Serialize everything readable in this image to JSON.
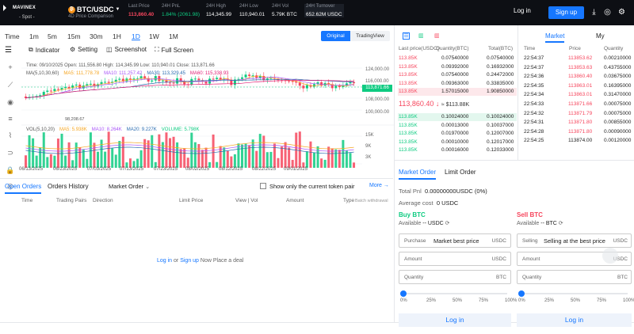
{
  "brand": {
    "name": "MAVINEX",
    "sub": "- Spot -"
  },
  "pair": {
    "name": "BTC/USDC",
    "sub": "4D Price Comparison"
  },
  "stats": [
    {
      "label": "Last Price",
      "value": "113,860.40",
      "color": "#f6465d"
    },
    {
      "label": "24H PnL",
      "value": "1.84% (2061.98)",
      "color": "#0ecb81"
    },
    {
      "label": "24H High",
      "value": "114,345.99",
      "color": "#ffffff"
    },
    {
      "label": "24H Low",
      "value": "110,940.01",
      "color": "#ffffff"
    },
    {
      "label": "24H Vol",
      "value": "5.79K BTC",
      "color": "#ffffff"
    },
    {
      "label": "24H Turnover",
      "value": "652.62M USDC",
      "color": "#ffffff"
    }
  ],
  "header": {
    "login": "Log in",
    "signup": "Sign up"
  },
  "timeframes": [
    "Time",
    "1m",
    "5m",
    "15m",
    "30m",
    "1H",
    "1D",
    "1W",
    "1M"
  ],
  "active_timeframe": "1D",
  "views": {
    "original": "Original",
    "tradingview": "TradingView"
  },
  "toolbar": {
    "indicator": "Indicator",
    "setting": "Setting",
    "screenshot": "Screenshot",
    "fullscreen": "Full Screen"
  },
  "chart_info": {
    "ohlc": "Time: 09/10/2025   Open: 111,556.80   High: 114,345.99   Low: 110,940.01   Close: 113,871.66",
    "ma_title": "MA(5,10,30,60)",
    "ma5": "MA5: 111,778.78",
    "ma10": "MA10: 111,257.42",
    "ma30": "MA30: 113,329.45",
    "ma60": "MA60: 115,338.93",
    "vol_title": "VOL(5,10,20)",
    "vma5": "MA5: 5.938K",
    "vma10": "MA10: 8.264K",
    "vma20": "MA20: 9.227K",
    "volume": "VOLUME: 5.798K",
    "last_label": "113,871.66",
    "low_label": "98,208.67",
    "y_price": [
      "124,000.00",
      "116,000.00",
      "108,000.00",
      "100,000.00"
    ],
    "y_vol": [
      "15K",
      "9K",
      "3K"
    ],
    "x_dates": [
      "06/13/2025",
      "06/23/2025",
      "07/03/2025",
      "07/13/2025",
      "07/23/2025",
      "08/02/2025",
      "08/12/2025",
      "08/22/2025",
      "09/01/2025"
    ]
  },
  "orders": {
    "tabs": [
      "Open Orders",
      "Orders History"
    ],
    "market_order": "Market Order",
    "checkbox": "Show only the current token pair",
    "more": "More",
    "columns": [
      "Time",
      "Trading Pairs",
      "Direction",
      "Limit Price",
      "View | Vol",
      "Amount",
      "Type"
    ],
    "extra_col": "Batch withdrawal",
    "login_prompt_a": "Log in",
    "login_prompt_or": " or ",
    "login_prompt_b": "Sign up",
    "login_prompt_c": " Now Place a deal"
  },
  "orderbook": {
    "headers": [
      "Last price(USDC)",
      "Quantity(BTC)",
      "Total(BTC)"
    ],
    "asks": [
      [
        "113.85K",
        "0.07540000",
        "0.07540000"
      ],
      [
        "113.85K",
        "0.09392000",
        "0.16932000"
      ],
      [
        "113.85K",
        "0.07540000",
        "0.24472000"
      ],
      [
        "113.85K",
        "0.09363000",
        "0.33835000"
      ],
      [
        "113.85K",
        "1.57015000",
        "1.90850000"
      ]
    ],
    "mid_price": "113,860.40",
    "mid_usd": "≈ $113.88K",
    "bids": [
      [
        "113.85K",
        "0.10024000",
        "0.10024000"
      ],
      [
        "113.85K",
        "0.00013000",
        "0.10037000"
      ],
      [
        "113.85K",
        "0.01970000",
        "0.12007000"
      ],
      [
        "113.85K",
        "0.00010000",
        "0.12017000"
      ],
      [
        "113.85K",
        "0.00016000",
        "0.12033000"
      ]
    ]
  },
  "market": {
    "tabs": [
      "Market",
      "My"
    ],
    "headers": [
      "Time",
      "Price",
      "Quantity"
    ],
    "trades": [
      [
        "22:54:37",
        "113853.62",
        "0.00210000",
        "red"
      ],
      [
        "22:54:37",
        "113853.63",
        "0.43755000",
        "red"
      ],
      [
        "22:54:36",
        "113860.40",
        "0.03675000",
        "red"
      ],
      [
        "22:54:35",
        "113863.01",
        "0.16395000",
        "red"
      ],
      [
        "22:54:34",
        "113863.01",
        "0.31470000",
        "red"
      ],
      [
        "22:54:33",
        "113871.66",
        "0.00075000",
        "red"
      ],
      [
        "22:54:32",
        "113871.79",
        "0.00075000",
        "red"
      ],
      [
        "22:54:31",
        "113871.80",
        "0.00855000",
        "red"
      ],
      [
        "22:54:28",
        "113871.80",
        "0.00090000",
        "red"
      ],
      [
        "22:54:25",
        "113874.00",
        "0.00120000",
        "black"
      ]
    ]
  },
  "trade": {
    "tabs": [
      "Market Order",
      "Limit Order"
    ],
    "total_pnl_label": "Total Pnl",
    "total_pnl_value": "0.00000000USDC (0%)",
    "avg_cost_label": "Average cost",
    "avg_cost_value": "0 USDC",
    "buy": {
      "title": "Buy BTC",
      "available_label": "Available",
      "available_value": "-- USDC",
      "price_label": "Purchase",
      "price_value": "Market best price",
      "price_unit": "USDC",
      "amount_label": "Amount",
      "amount_unit": "USDC",
      "qty_label": "Quantity",
      "qty_unit": "BTC",
      "button": "Log in"
    },
    "sell": {
      "title": "Sell BTC",
      "available_label": "Available",
      "available_value": "-- BTC",
      "price_label": "Selling",
      "price_value": "Selling at the best price",
      "price_unit": "USDC",
      "amount_label": "Amount",
      "amount_unit": "USDC",
      "qty_label": "Quantity",
      "qty_unit": "BTC",
      "button": "Log in"
    },
    "pcts": [
      "0%",
      "25%",
      "50%",
      "75%",
      "100%"
    ]
  }
}
